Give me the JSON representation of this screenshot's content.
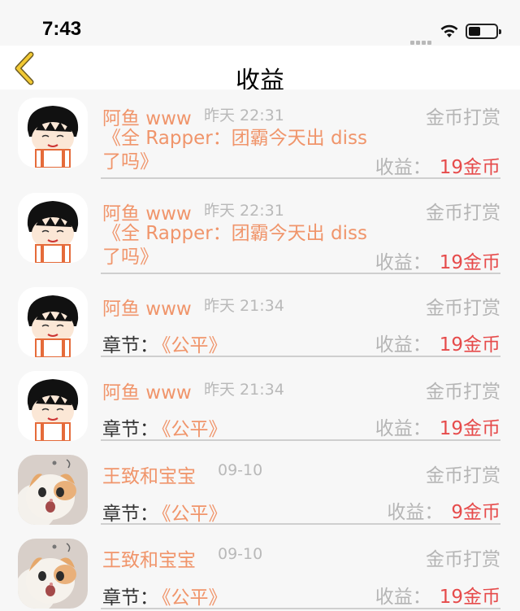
{
  "status": {
    "time": "7:43"
  },
  "nav": {
    "title": "收益"
  },
  "items": [
    {
      "name": "阿鱼 www",
      "time": "昨天 22:31",
      "type": "金币打赏",
      "work_line1": "《全 Rapper：团霸今天出 diss",
      "work_line2": "了吗》",
      "earn_label": "收益：",
      "earn_value": "19金币",
      "avatar": "cartoon-girl-avatar"
    },
    {
      "name": "阿鱼 www",
      "time": "昨天 22:31",
      "type": "金币打赏",
      "work_line1": "《全 Rapper：团霸今天出 diss",
      "work_line2": "了吗》",
      "earn_label": "收益：",
      "earn_value": "19金币",
      "avatar": "cartoon-girl-avatar"
    },
    {
      "name": "阿鱼 www",
      "time": "昨天 21:34",
      "type": "金币打赏",
      "chapter_label": "章节：",
      "chapter_value": "《公平》",
      "earn_label": "收益：",
      "earn_value": "19金币",
      "avatar": "cartoon-girl-avatar"
    },
    {
      "name": "阿鱼 www",
      "time": "昨天 21:34",
      "type": "金币打赏",
      "chapter_label": "章节：",
      "chapter_value": "《公平》",
      "earn_label": "收益：",
      "earn_value": "19金币",
      "avatar": "cartoon-girl-avatar"
    },
    {
      "name": "王致和宝宝",
      "time": "09-10",
      "type": "金币打赏",
      "chapter_label": "章节：",
      "chapter_value": "《公平》",
      "earn_label": "收益：",
      "earn_value": "9金币",
      "avatar": "cat-avatar"
    },
    {
      "name": "王致和宝宝",
      "time": "09-10",
      "type": "金币打赏",
      "chapter_label": "章节：",
      "chapter_value": "《公平》",
      "earn_label": "收益：",
      "earn_value": "19金币",
      "avatar": "cat-avatar"
    }
  ]
}
